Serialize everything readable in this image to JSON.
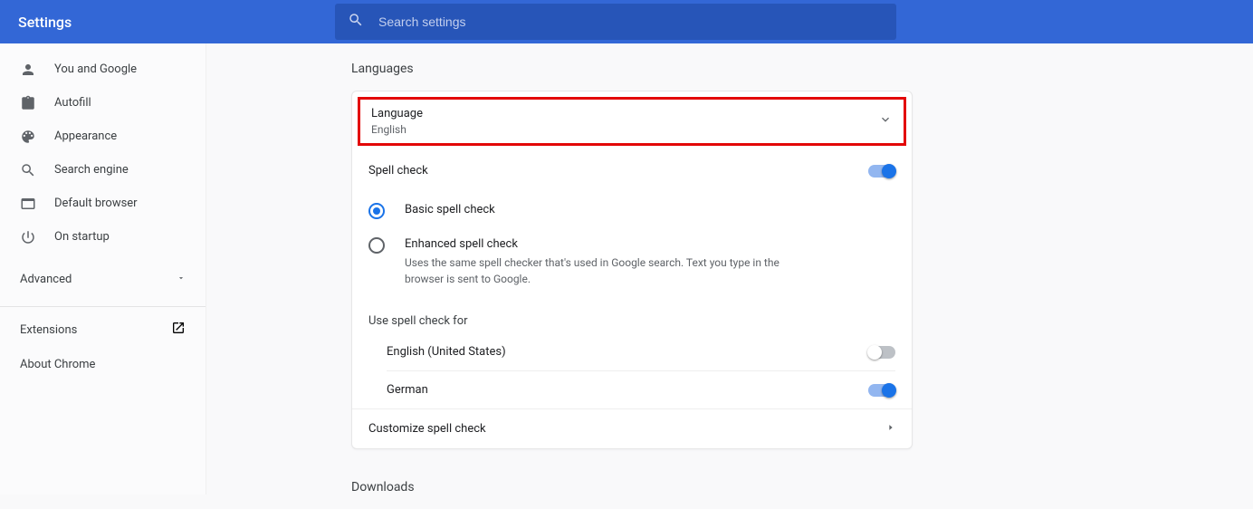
{
  "header": {
    "title": "Settings",
    "search_placeholder": "Search settings"
  },
  "sidebar": {
    "items": [
      {
        "label": "You and Google"
      },
      {
        "label": "Autofill"
      },
      {
        "label": "Appearance"
      },
      {
        "label": "Search engine"
      },
      {
        "label": "Default browser"
      },
      {
        "label": "On startup"
      }
    ],
    "advanced": "Advanced",
    "extensions": "Extensions",
    "about": "About Chrome"
  },
  "main": {
    "languages_title": "Languages",
    "language_row": {
      "label": "Language",
      "value": "English"
    },
    "spell_check_label": "Spell check",
    "spell_check_on": true,
    "radios": {
      "basic": "Basic spell check",
      "enhanced": "Enhanced spell check",
      "enhanced_desc": "Uses the same spell checker that's used in Google search. Text you type in the browser is sent to Google."
    },
    "use_for_label": "Use spell check for",
    "langs": [
      {
        "name": "English (United States)",
        "on": false
      },
      {
        "name": "German",
        "on": true
      }
    ],
    "customize": "Customize spell check",
    "downloads_title": "Downloads"
  }
}
